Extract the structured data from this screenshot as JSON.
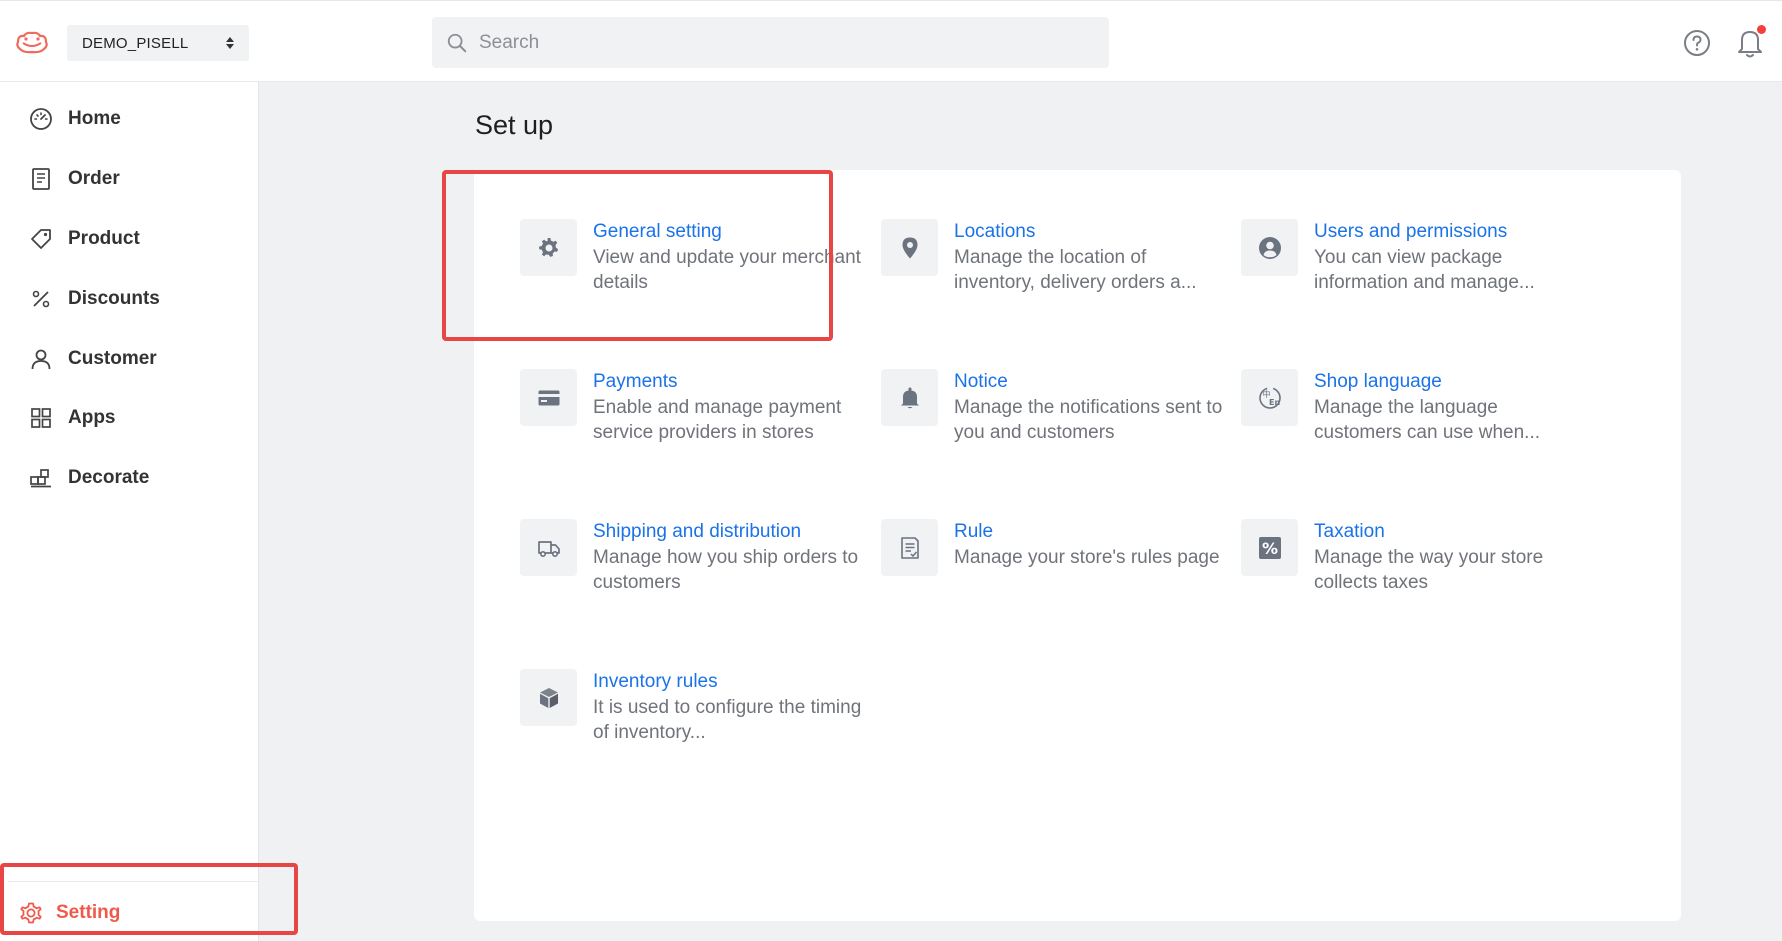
{
  "header": {
    "store_name": "DEMO_PISELL",
    "search_placeholder": "Search"
  },
  "sidebar": {
    "items": [
      {
        "label": "Home"
      },
      {
        "label": "Order"
      },
      {
        "label": "Product"
      },
      {
        "label": "Discounts"
      },
      {
        "label": "Customer"
      },
      {
        "label": "Apps"
      },
      {
        "label": "Decorate"
      }
    ],
    "setting_label": "Setting"
  },
  "main": {
    "title": "Set up",
    "cards": [
      {
        "title": "General setting",
        "desc": "View and update your merchant details",
        "icon": "gear-icon"
      },
      {
        "title": "Locations",
        "desc": "Manage the location of inventory, delivery orders a...",
        "icon": "map-pin-icon"
      },
      {
        "title": "Users and permissions",
        "desc": "You can view package information and manage...",
        "icon": "user-circle-icon"
      },
      {
        "title": "Payments",
        "desc": "Enable and manage payment service providers in stores",
        "icon": "credit-card-icon"
      },
      {
        "title": "Notice",
        "desc": "Manage the notifications sent to you and customers",
        "icon": "bell-icon"
      },
      {
        "title": "Shop language",
        "desc": "Manage the language customers can use when...",
        "icon": "language-icon"
      },
      {
        "title": "Shipping and distribution",
        "desc": "Manage how you ship orders to customers",
        "icon": "truck-icon"
      },
      {
        "title": "Rule",
        "desc": "Manage your store's rules page",
        "icon": "document-icon"
      },
      {
        "title": "Taxation",
        "desc": "Manage the way your store collects taxes",
        "icon": "percent-icon"
      },
      {
        "title": "Inventory rules",
        "desc": "It is used to configure the timing of inventory...",
        "icon": "box-icon"
      }
    ]
  },
  "colors": {
    "accent_link": "#1a73e8",
    "highlight": "#e84545",
    "setting_active": "#f05a4b",
    "icon_gray": "#6b7280"
  }
}
